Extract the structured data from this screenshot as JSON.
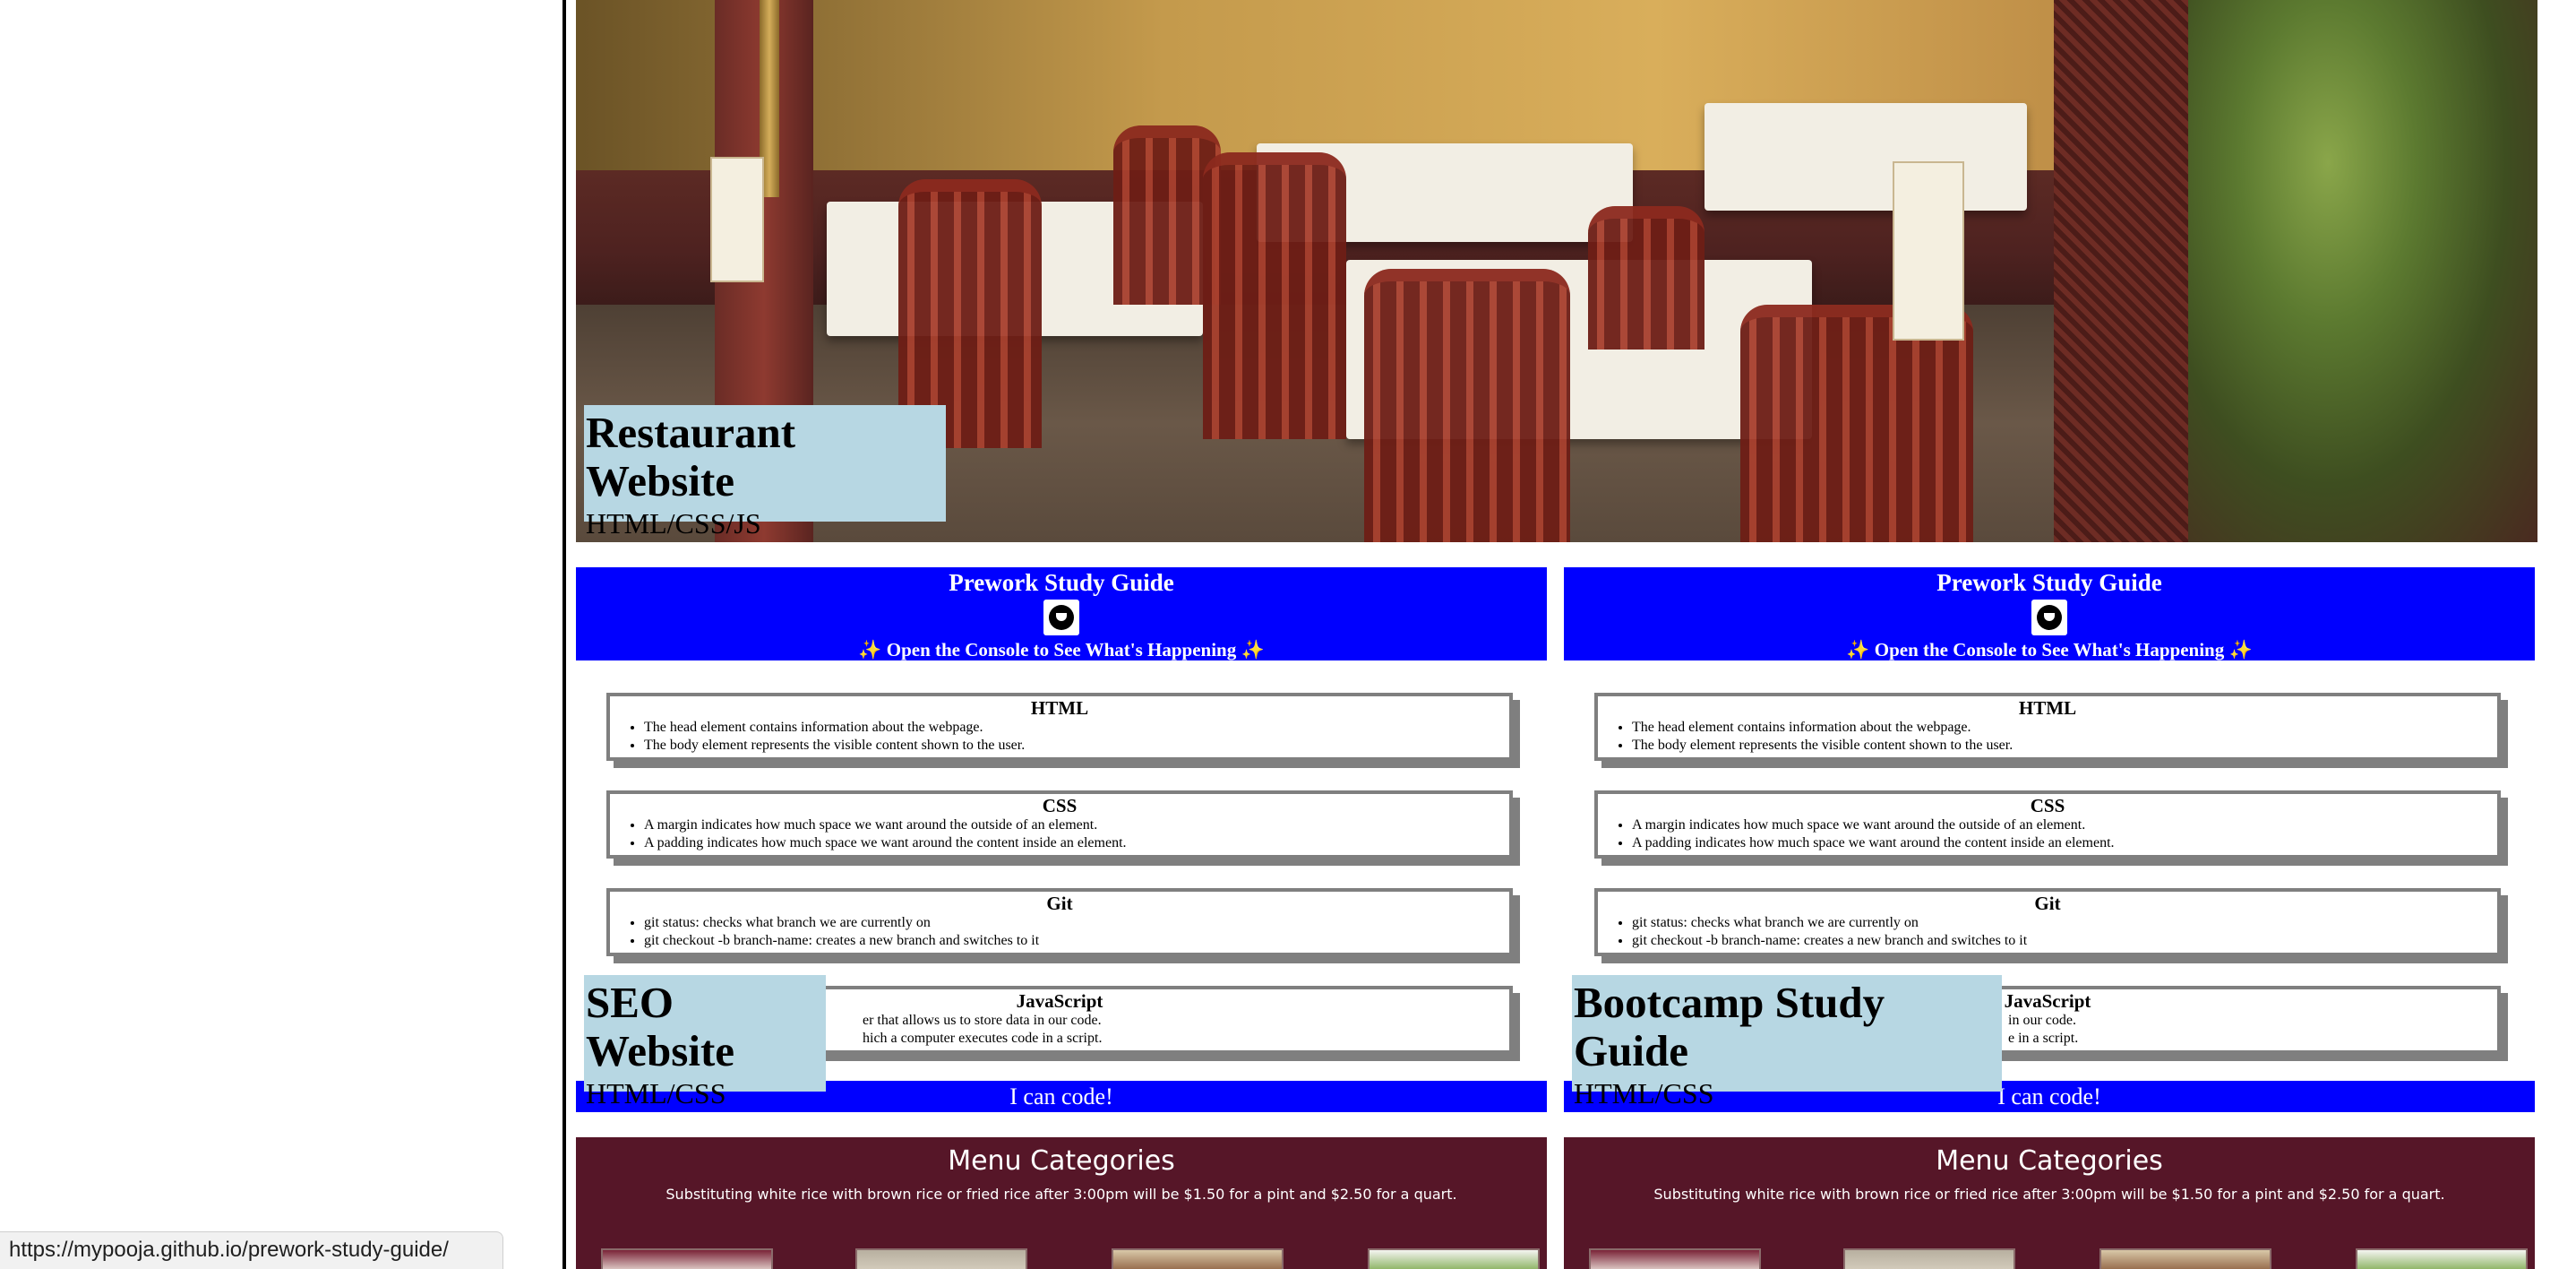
{
  "hero": {
    "title": "Restaurant Website",
    "subtitle": "HTML/CSS/JS"
  },
  "cards": [
    {
      "header_title": "Prework Study Guide",
      "header_console": "✨ Open the Console to See What's Happening ✨",
      "topics": [
        {
          "title": "HTML",
          "items": [
            "The head element contains information about the webpage.",
            "The body element represents the visible content shown to the user."
          ]
        },
        {
          "title": "CSS",
          "items": [
            "A margin indicates how much space we want around the outside of an element.",
            "A padding indicates how much space we want around the content inside an element."
          ]
        },
        {
          "title": "Git",
          "items": [
            "git status: checks what branch we are currently on",
            "git checkout -b branch-name: creates a new branch and switches to it"
          ]
        },
        {
          "title": "JavaScript",
          "items": [
            "er that allows us to store data in our code.",
            "hich a computer executes code in a script."
          ]
        }
      ],
      "footer": "I can code!",
      "menu_title": "Menu Categories",
      "menu_note": "Substituting white rice with brown rice or fried rice after 3:00pm will be $1.50 for a pint and $2.50 for a quart.",
      "caption_title": "SEO Website",
      "caption_sub": "HTML/CSS"
    },
    {
      "header_title": "Prework Study Guide",
      "header_console": "✨ Open the Console to See What's Happening ✨",
      "topics": [
        {
          "title": "HTML",
          "items": [
            "The head element contains information about the webpage.",
            "The body element represents the visible content shown to the user."
          ]
        },
        {
          "title": "CSS",
          "items": [
            "A margin indicates how much space we want around the outside of an element.",
            "A padding indicates how much space we want around the content inside an element."
          ]
        },
        {
          "title": "Git",
          "items": [
            "git status: checks what branch we are currently on",
            "git checkout -b branch-name: creates a new branch and switches to it"
          ]
        },
        {
          "title": "JavaScript",
          "items": [
            "in our code.",
            "e in a script."
          ]
        }
      ],
      "footer": "I can code!",
      "menu_title": "Menu Categories",
      "menu_note": "Substituting white rice with brown rice or fried rice after 3:00pm will be $1.50 for a pint and $2.50 for a quart.",
      "caption_title": "Bootcamp Study Guide",
      "caption_sub": "HTML/CSS"
    }
  ],
  "status_bar": {
    "url": "https://mypooja.github.io/prework-study-guide/"
  },
  "colors": {
    "header_blue": "#0000ff",
    "caption_bg": "#b7d7e3",
    "menu_maroon": "#561628"
  }
}
